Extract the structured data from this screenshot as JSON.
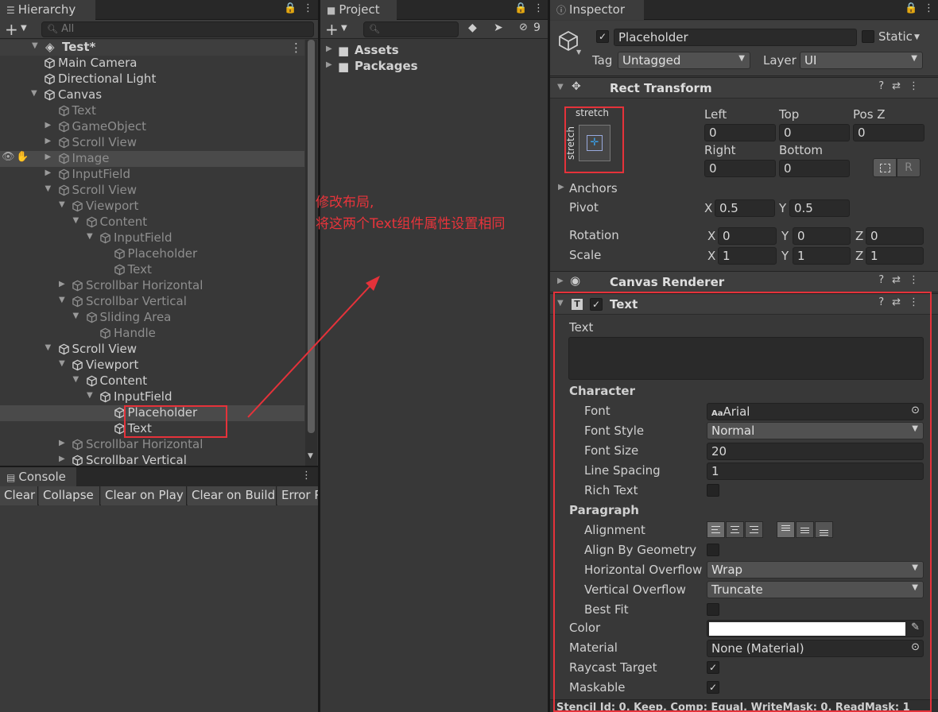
{
  "hierarchy": {
    "tab": "Hierarchy",
    "search_placeholder": "All",
    "scene": "Test*",
    "items": [
      {
        "label": "Main Camera",
        "depth": 2,
        "arrow": "",
        "dim": false,
        "sel": false
      },
      {
        "label": "Directional Light",
        "depth": 2,
        "arrow": "",
        "dim": false,
        "sel": false
      },
      {
        "label": "Canvas",
        "depth": 2,
        "arrow": "down",
        "dim": false,
        "sel": false
      },
      {
        "label": "Text",
        "depth": 3,
        "arrow": "",
        "dim": true,
        "sel": false
      },
      {
        "label": "GameObject",
        "depth": 3,
        "arrow": "right",
        "dim": true,
        "sel": false
      },
      {
        "label": "Scroll View",
        "depth": 3,
        "arrow": "right",
        "dim": true,
        "sel": false
      },
      {
        "label": "Image",
        "depth": 3,
        "arrow": "right",
        "dim": true,
        "sel": true
      },
      {
        "label": "InputField",
        "depth": 3,
        "arrow": "right",
        "dim": true,
        "sel": false
      },
      {
        "label": "Scroll View",
        "depth": 3,
        "arrow": "down",
        "dim": true,
        "sel": false
      },
      {
        "label": "Viewport",
        "depth": 4,
        "arrow": "down",
        "dim": true,
        "sel": false
      },
      {
        "label": "Content",
        "depth": 5,
        "arrow": "down",
        "dim": true,
        "sel": false
      },
      {
        "label": "InputField",
        "depth": 6,
        "arrow": "down",
        "dim": true,
        "sel": false
      },
      {
        "label": "Placeholder",
        "depth": 7,
        "arrow": "",
        "dim": true,
        "sel": false
      },
      {
        "label": "Text",
        "depth": 7,
        "arrow": "",
        "dim": true,
        "sel": false
      },
      {
        "label": "Scrollbar Horizontal",
        "depth": 4,
        "arrow": "right",
        "dim": true,
        "sel": false
      },
      {
        "label": "Scrollbar Vertical",
        "depth": 4,
        "arrow": "down",
        "dim": true,
        "sel": false
      },
      {
        "label": "Sliding Area",
        "depth": 5,
        "arrow": "down",
        "dim": true,
        "sel": false
      },
      {
        "label": "Handle",
        "depth": 6,
        "arrow": "",
        "dim": true,
        "sel": false
      },
      {
        "label": "Scroll View",
        "depth": 3,
        "arrow": "down",
        "dim": false,
        "sel": false
      },
      {
        "label": "Viewport",
        "depth": 4,
        "arrow": "down",
        "dim": false,
        "sel": false
      },
      {
        "label": "Content",
        "depth": 5,
        "arrow": "down",
        "dim": false,
        "sel": false
      },
      {
        "label": "InputField",
        "depth": 6,
        "arrow": "down",
        "dim": false,
        "sel": false
      },
      {
        "label": "Placeholder",
        "depth": 7,
        "arrow": "",
        "dim": false,
        "sel": true
      },
      {
        "label": "Text",
        "depth": 7,
        "arrow": "",
        "dim": false,
        "sel": false
      },
      {
        "label": "Scrollbar Horizontal",
        "depth": 4,
        "arrow": "right",
        "dim": true,
        "sel": false
      },
      {
        "label": "Scrollbar Vertical",
        "depth": 4,
        "arrow": "right",
        "dim": false,
        "sel": false
      }
    ]
  },
  "console": {
    "tab": "Console",
    "buttons": [
      "Clear",
      "Collapse",
      "Clear on Play",
      "Clear on Build",
      "Error P"
    ]
  },
  "project": {
    "tab": "Project",
    "hidden_count": "9",
    "folders": [
      "Assets",
      "Packages"
    ]
  },
  "annotation": {
    "line1": "修改布局,",
    "line2": "将这两个Text组件属性设置相同"
  },
  "inspector": {
    "tab": "Inspector",
    "object_name": "Placeholder",
    "static_label": "Static",
    "tag_label": "Tag",
    "tag_value": "Untagged",
    "layer_label": "Layer",
    "layer_value": "UI",
    "rect": {
      "title": "Rect Transform",
      "anchor_h": "stretch",
      "anchor_v": "stretch",
      "left_label": "Left",
      "left": "0",
      "top_label": "Top",
      "top": "0",
      "posz_label": "Pos Z",
      "posz": "0",
      "right_label": "Right",
      "right": "0",
      "bottom_label": "Bottom",
      "bottom": "0",
      "r_btn": "R",
      "anchors_label": "Anchors",
      "pivot_label": "Pivot",
      "pivot_x": "0.5",
      "pivot_y": "0.5",
      "rotation_label": "Rotation",
      "rot_x": "0",
      "rot_y": "0",
      "rot_z": "0",
      "scale_label": "Scale",
      "scale_x": "1",
      "scale_y": "1",
      "scale_z": "1",
      "x": "X",
      "y": "Y",
      "z": "Z"
    },
    "canvas_renderer": {
      "title": "Canvas Renderer"
    },
    "text": {
      "title": "Text",
      "text_label": "Text",
      "text_value": "",
      "character_label": "Character",
      "font_label": "Font",
      "font_value": "Arial",
      "font_prefix": "Aa",
      "font_style_label": "Font Style",
      "font_style_value": "Normal",
      "font_size_label": "Font Size",
      "font_size_value": "20",
      "line_spacing_label": "Line Spacing",
      "line_spacing_value": "1",
      "rich_text_label": "Rich Text",
      "paragraph_label": "Paragraph",
      "alignment_label": "Alignment",
      "align_geometry_label": "Align By Geometry",
      "h_overflow_label": "Horizontal Overflow",
      "h_overflow_value": "Wrap",
      "v_overflow_label": "Vertical Overflow",
      "v_overflow_value": "Truncate",
      "best_fit_label": "Best Fit",
      "color_label": "Color",
      "color_value": "#ffffff",
      "material_label": "Material",
      "material_value": "None (Material)",
      "raycast_label": "Raycast Target",
      "maskable_label": "Maskable"
    },
    "bottom_cut": "Stencil Id: 0, Keep, Comp: Equal, WriteMask: 0, ReadMask: 1"
  }
}
